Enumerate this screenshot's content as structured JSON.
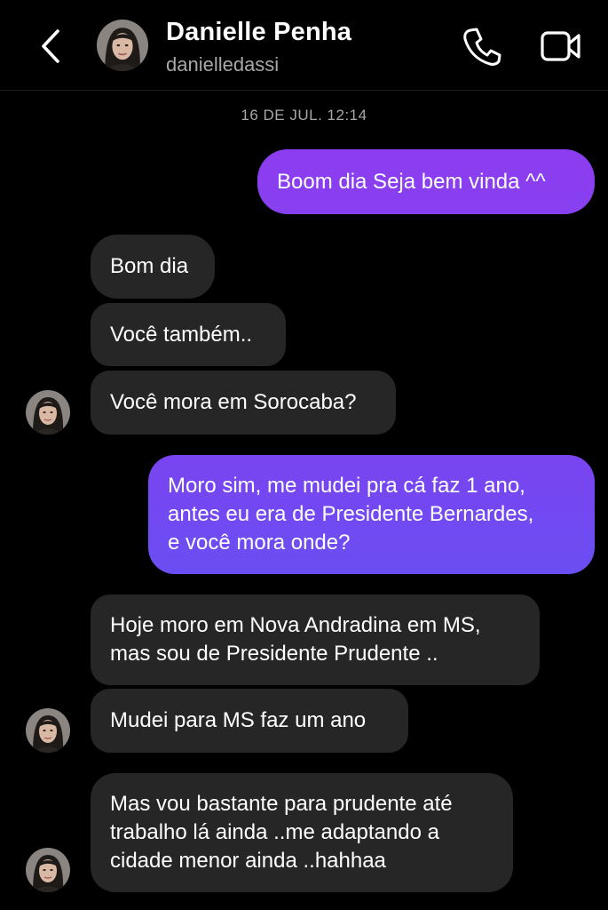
{
  "header": {
    "name": "Danielle Penha",
    "username": "danielledassi"
  },
  "timestamp": "16 DE JUL. 12:14",
  "messages": [
    {
      "text": "Boom dia Seja bem vinda ^^"
    },
    {
      "text": "Bom dia"
    },
    {
      "text": "Você também.."
    },
    {
      "text": "Você mora em Sorocaba?"
    },
    {
      "text": "Moro sim, me mudei pra cá faz 1 ano,\nantes eu era de Presidente Bernardes,\ne você mora onde?"
    },
    {
      "text": "Hoje moro em Nova Andradina em MS,\nmas sou de Presidente Prudente .."
    },
    {
      "text": "Mudei para MS faz um ano"
    },
    {
      "text": "Mas vou bastante para prudente até\ntrabalho lá ainda ..me adaptando a\ncidade menor ainda ..hahhaa"
    }
  ],
  "icons": {
    "back": "chevron-left-icon",
    "call": "phone-icon",
    "video": "video-camera-icon"
  },
  "colors": {
    "outgoing_top": "#8e3ef0",
    "outgoing_bottom": "#6a4ef2",
    "incoming": "#262626",
    "background": "#000000"
  }
}
